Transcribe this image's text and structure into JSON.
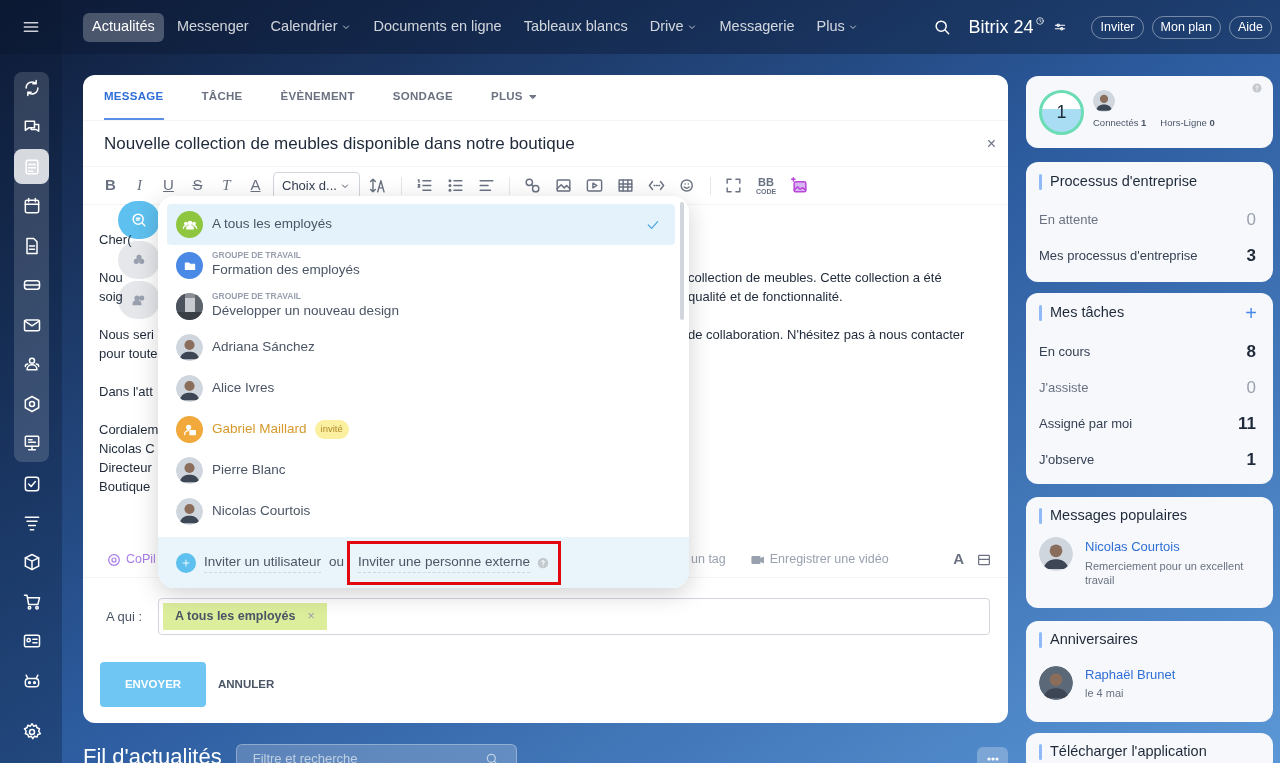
{
  "top_nav": {
    "items": [
      {
        "label": "Actualités",
        "selected": true,
        "dropdown": false
      },
      {
        "label": "Messenger",
        "selected": false,
        "dropdown": false
      },
      {
        "label": "Calendrier",
        "selected": false,
        "dropdown": true
      },
      {
        "label": "Documents en ligne",
        "selected": false,
        "dropdown": false
      },
      {
        "label": "Tableaux blancs",
        "selected": false,
        "dropdown": false
      },
      {
        "label": "Drive",
        "selected": false,
        "dropdown": true
      },
      {
        "label": "Messagerie",
        "selected": false,
        "dropdown": false
      },
      {
        "label": "Plus",
        "selected": false,
        "dropdown": true
      }
    ],
    "logo": "Bitrix 24",
    "buttons": [
      "Inviter",
      "Mon plan",
      "Aide"
    ]
  },
  "left_sidebar": {
    "items": [
      {
        "selected": false
      },
      {
        "selected": false
      },
      {
        "selected": true
      },
      {
        "selected": false
      },
      {
        "selected": false
      },
      {
        "selected": false
      },
      {
        "selected": false
      },
      {
        "selected": false
      },
      {
        "selected": false
      },
      {
        "selected": false
      },
      {
        "selected": false
      },
      {
        "selected": false
      },
      {
        "selected": false
      },
      {
        "selected": false
      },
      {
        "selected": false
      },
      {
        "selected": false
      },
      {
        "selected": false
      }
    ]
  },
  "composer": {
    "tabs": [
      {
        "label": "MESSAGE",
        "selected": true,
        "dropdown": false
      },
      {
        "label": "TÂCHE",
        "selected": false,
        "dropdown": false
      },
      {
        "label": "ÈVÈNEMENT",
        "selected": false,
        "dropdown": false
      },
      {
        "label": "SONDAGE",
        "selected": false,
        "dropdown": false
      },
      {
        "label": "PLUS",
        "selected": false,
        "dropdown": true
      }
    ],
    "title": "Nouvelle collection de meubles disponible dans notre boutique",
    "close": "×",
    "format_buttons": [
      {
        "kind": "bold",
        "glyph": "B"
      },
      {
        "kind": "italic",
        "glyph": "I"
      },
      {
        "kind": "underline",
        "glyph": "U"
      },
      {
        "kind": "strike",
        "glyph": "S"
      },
      {
        "kind": "clear",
        "glyph": "T"
      },
      {
        "kind": "color",
        "glyph": "A"
      }
    ],
    "font_select": "Choix d...",
    "bbcode": {
      "label": "BB",
      "caption": "CODE"
    },
    "body": [
      [
        {
          "left": "Cher("
        }
      ],
      [
        {
          "left": "Nou",
          "right": "collection de meubles. Cette collection a été"
        },
        {
          "left": "soig",
          "right": "qualité et de fonctionnalité."
        }
      ],
      [
        {
          "left": "Nous seri",
          "right": "de collaboration. N'hésitez pas à nous contacter"
        },
        {
          "left": "pour toute"
        }
      ],
      [
        {
          "left": "Dans l'att"
        }
      ],
      [
        {
          "left": "Cordialem"
        },
        {
          "left": "Nicolas C"
        },
        {
          "left": "Directeur"
        },
        {
          "left": "Boutique"
        }
      ]
    ],
    "tools": {
      "copilot": "CoPil",
      "tag": "un tag",
      "video": "Enregistrer une vidéo",
      "font_glyph": "A"
    },
    "recipients": {
      "label": "A qui :",
      "tags": [
        {
          "label": "A tous les employés",
          "remove": "×"
        }
      ]
    },
    "buttons": {
      "send": "ENVOYER",
      "cancel": "ANNULER"
    },
    "selector": {
      "items": [
        {
          "kind": "all",
          "label": "A tous les employés",
          "selected": true
        },
        {
          "kind": "group",
          "caption": "GROUPE DE TRAVAIL",
          "label": "Formation des employés",
          "selected": false
        },
        {
          "kind": "group-photo",
          "caption": "GROUPE DE TRAVAIL",
          "label": "Développer un nouveau design",
          "selected": false
        },
        {
          "kind": "user",
          "label": "Adriana Sánchez",
          "selected": false
        },
        {
          "kind": "user",
          "label": "Alice Ivres",
          "selected": false
        },
        {
          "kind": "invited",
          "label": "Gabriel Maillard",
          "badge": "invité",
          "selected": false
        },
        {
          "kind": "user",
          "label": "Pierre Blanc",
          "selected": false
        },
        {
          "kind": "user",
          "label": "Nicolas Courtois",
          "selected": false
        }
      ],
      "footer": {
        "invite_user": "Inviter un utilisateur",
        "or": "ou",
        "invite_external": "Inviter une personne externe",
        "highlighted": true
      }
    }
  },
  "widgets": {
    "online": {
      "count": "1",
      "connected_label": "Connectés",
      "connected": "1",
      "offline_label": "Hors-Ligne",
      "offline": "0"
    },
    "processes": {
      "title": "Processus d'entreprise",
      "rows": [
        {
          "label": "En attente",
          "value": "0",
          "dim": true
        },
        {
          "label": "Mes processus d'entreprise",
          "value": "3",
          "dim": false
        }
      ]
    },
    "tasks": {
      "title": "Mes tâches",
      "add": "+",
      "rows": [
        {
          "label": "En cours",
          "value": "8",
          "dim": false
        },
        {
          "label": "J'assiste",
          "value": "0",
          "dim": true
        },
        {
          "label": "Assigné par moi",
          "value": "11",
          "dim": false
        },
        {
          "label": "J'observe",
          "value": "1",
          "dim": false
        }
      ]
    },
    "popular": {
      "title": "Messages populaires",
      "name": "Nicolas Courtois",
      "text": "Remerciement pour un excellent travail"
    },
    "birthdays": {
      "title": "Anniversaires",
      "name": "Raphaël Brunet",
      "date": "le 4 mai"
    },
    "download": {
      "title": "Télécharger l'application"
    }
  },
  "feed": {
    "title": "Fil d'actualités",
    "search_placeholder": "Filtre et recherche"
  }
}
